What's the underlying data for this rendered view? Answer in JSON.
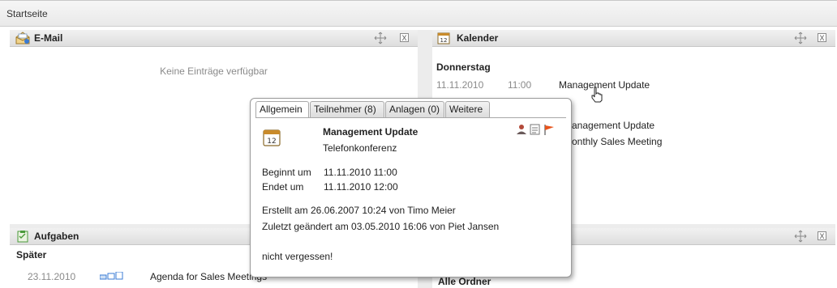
{
  "breadcrumb": {
    "label": "Startseite"
  },
  "email": {
    "title": "E-Mail",
    "empty_text": "Keine Einträge verfügbar"
  },
  "calendar": {
    "title": "Kalender",
    "day": "Donnerstag",
    "first_item": {
      "date": "11.11.2010",
      "time": "11:00",
      "title": "Management Update"
    },
    "items": [
      {
        "title": "Management Update"
      },
      {
        "title": "Monthly Sales Meeting"
      }
    ],
    "close_label": "X"
  },
  "tasks": {
    "title": "Aufgaben",
    "group": "Später",
    "items": [
      {
        "date": "23.11.2010",
        "title": "Agenda for Sales Meetings"
      }
    ]
  },
  "folders": {
    "title": "Alle Ordner"
  },
  "popup": {
    "tabs": [
      {
        "label": "Allgemein"
      },
      {
        "label": "Teilnehmer (8)"
      },
      {
        "label": "Anlagen (0)"
      },
      {
        "label": "Weitere"
      }
    ],
    "event_title": "Management Update",
    "event_location": "Telefonkonferenz",
    "calendar_icon_day": "12",
    "start_label": "Beginnt um",
    "start_value": "11.11.2010 11:00",
    "end_label": "Endet um",
    "end_value": "11.11.2010 12:00",
    "created": "Erstellt am 26.06.2007 10:24 von Timo Meier",
    "modified": "Zuletzt geändert am 03.05.2010 16:06 von Piet Jansen",
    "note": "nicht vergessen!"
  },
  "colors": {
    "accent_blue": "#3a7bd5",
    "flag": "#e8541c",
    "calendar_icon": "#c98b2b",
    "tasks_icon": "#4a9a3a"
  }
}
